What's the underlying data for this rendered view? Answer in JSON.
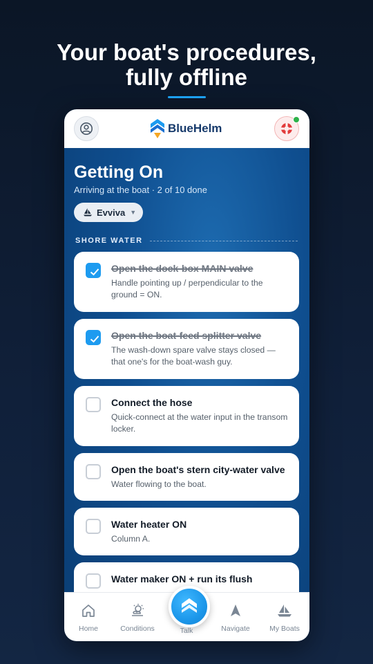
{
  "headline": {
    "line1": "Your boat's procedures,",
    "line2": "fully offline"
  },
  "app": {
    "brand": "BlueHelm",
    "accent": "#1d9bf0",
    "profile_icon": "user-circle-icon",
    "help_icon": "lifebuoy-icon",
    "status": "online"
  },
  "screen": {
    "title": "Getting On",
    "subtitle": "Arriving at the boat · 2 of 10 done",
    "boat_selector": {
      "icon": "sailboat-icon",
      "label": "Evviva"
    }
  },
  "section": {
    "title": "SHORE WATER"
  },
  "tasks": [
    {
      "title": "Open the dock-box MAIN valve",
      "description": "Handle pointing up / perpendicular to the ground = ON.",
      "done": true
    },
    {
      "title": "Open the boat-feed splitter valve",
      "description": "The wash-down spare valve stays closed — that one's for the boat-wash guy.",
      "done": true
    },
    {
      "title": "Connect the hose",
      "description": "Quick-connect at the water input in the transom locker.",
      "done": false
    },
    {
      "title": "Open the boat's stern city-water valve",
      "description": "Water flowing to the boat.",
      "done": false
    },
    {
      "title": "Water heater ON",
      "description": "Column A.",
      "done": false
    },
    {
      "title": "Water maker ON + run its flush",
      "description": "",
      "done": false
    }
  ],
  "tabs": [
    {
      "label": "Home",
      "icon": "home-icon"
    },
    {
      "label": "Conditions",
      "icon": "weather-icon"
    },
    {
      "label": "Talk",
      "icon": "talk-icon"
    },
    {
      "label": "Navigate",
      "icon": "navigation-arrow-icon"
    },
    {
      "label": "My Boats",
      "icon": "sailboat-icon"
    }
  ]
}
